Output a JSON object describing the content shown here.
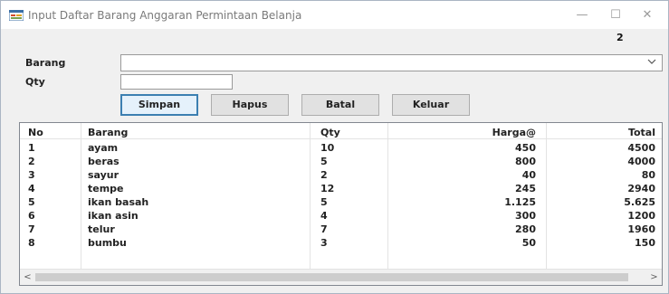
{
  "window": {
    "title": "Input Daftar Barang Anggaran Permintaan Belanja",
    "minimize_glyph": "—",
    "maximize_glyph": "☐",
    "close_glyph": "✕"
  },
  "counter": "2",
  "form": {
    "barang_label": "Barang",
    "barang_value": "",
    "qty_label": "Qty",
    "qty_value": ""
  },
  "buttons": {
    "simpan": "Simpan",
    "hapus": "Hapus",
    "batal": "Batal",
    "keluar": "Keluar"
  },
  "table": {
    "columns": [
      "No",
      "Barang",
      "Qty",
      "Harga@",
      "Total"
    ],
    "rows": [
      [
        "1",
        "ayam",
        "10",
        "450",
        "4500"
      ],
      [
        "2",
        "beras",
        "5",
        "800",
        "4000"
      ],
      [
        "3",
        "sayur",
        "2",
        "40",
        "80"
      ],
      [
        "4",
        "tempe",
        "12",
        "245",
        "2940"
      ],
      [
        "5",
        "ikan basah",
        "5",
        "1.125",
        "5.625"
      ],
      [
        "6",
        "ikan asin",
        "4",
        "300",
        "1200"
      ],
      [
        "7",
        "telur",
        "7",
        "280",
        "1960"
      ],
      [
        "8",
        "bumbu",
        "3",
        "50",
        "150"
      ]
    ]
  },
  "scroll": {
    "left_glyph": "<",
    "right_glyph": ">"
  },
  "icons": {
    "app": "form-icon",
    "dropdown": "chevron-down-icon"
  }
}
